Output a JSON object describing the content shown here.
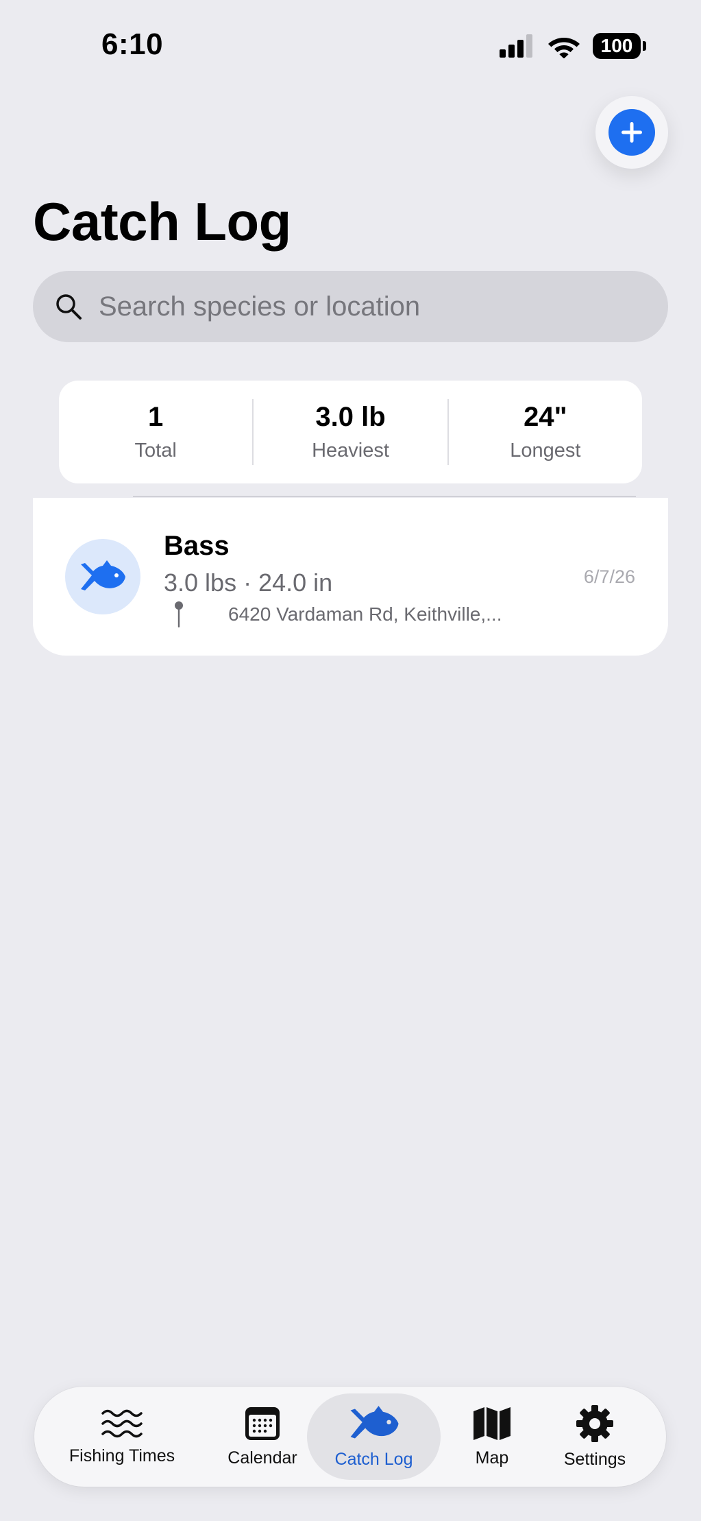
{
  "status_bar": {
    "time": "6:10",
    "battery": "100"
  },
  "page": {
    "title": "Catch Log"
  },
  "search": {
    "placeholder": "Search species or location"
  },
  "stats": [
    {
      "value": "1",
      "label": "Total"
    },
    {
      "value": "3.0 lb",
      "label": "Heaviest"
    },
    {
      "value": "24\"",
      "label": "Longest"
    }
  ],
  "catches": [
    {
      "species": "Bass",
      "measurements": "3.0 lbs · 24.0 in",
      "location": "6420 Vardaman Rd, Keithville,...",
      "date": "6/7/26",
      "icon": "fish-icon"
    }
  ],
  "tab_bar": {
    "active": "Catch Log",
    "tabs": [
      {
        "label": "Fishing Times",
        "icon": "waves-icon"
      },
      {
        "label": "Calendar",
        "icon": "calendar-icon"
      },
      {
        "label": "Catch Log",
        "icon": "fish-icon"
      },
      {
        "label": "Map",
        "icon": "map-icon"
      },
      {
        "label": "Settings",
        "icon": "gear-icon"
      }
    ]
  },
  "colors": {
    "accent": "#1E6FF0",
    "active_tab_label": "#1E5FD0",
    "background": "#EBEBF0",
    "fish_badge": "#DCE8FB"
  }
}
